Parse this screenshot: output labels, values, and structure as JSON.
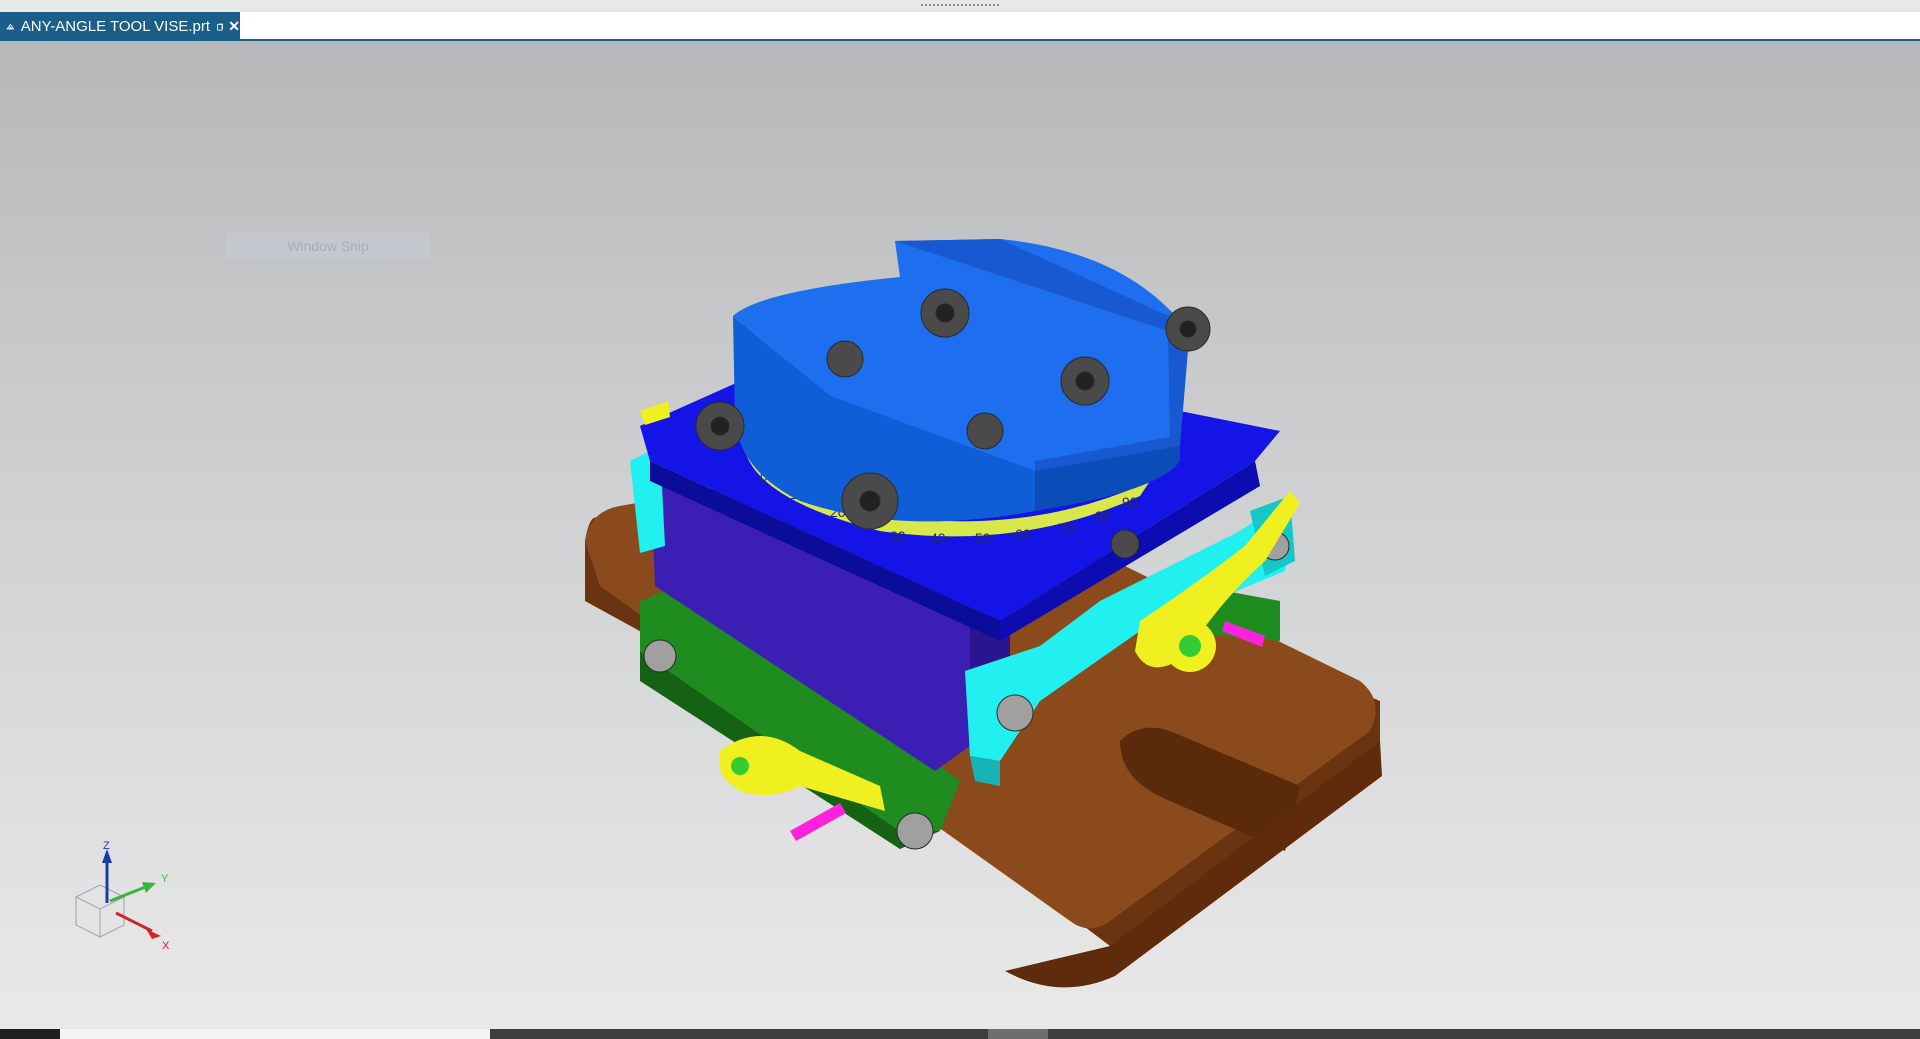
{
  "tab": {
    "title": "ANY-ANGLE TOOL VISE.prt",
    "close_glyph": "✕"
  },
  "overlay": {
    "window_snip_label": "Window Snip"
  },
  "dial": {
    "ticks": [
      "0",
      "10",
      "20",
      "30",
      "40",
      "50",
      "60",
      "70",
      "80",
      "90"
    ]
  },
  "triad": {
    "z_label": "Z",
    "y_label": "Y",
    "x_label": "X"
  },
  "colors": {
    "tab_bg": "#1a5f8a",
    "base": "#7a3f16",
    "jaw": "#1e6ef0",
    "table": "#1414e6",
    "side_plate": "#3b1fb5",
    "clamp": "#22f0f0",
    "handle": "#f0f020",
    "lower_rail": "#1f8c1f",
    "pin": "#ff22dd",
    "dial": "#d8e84a"
  },
  "icons": {
    "app": "nx-part-icon",
    "restore": "restore-window-icon",
    "close": "close-icon"
  }
}
